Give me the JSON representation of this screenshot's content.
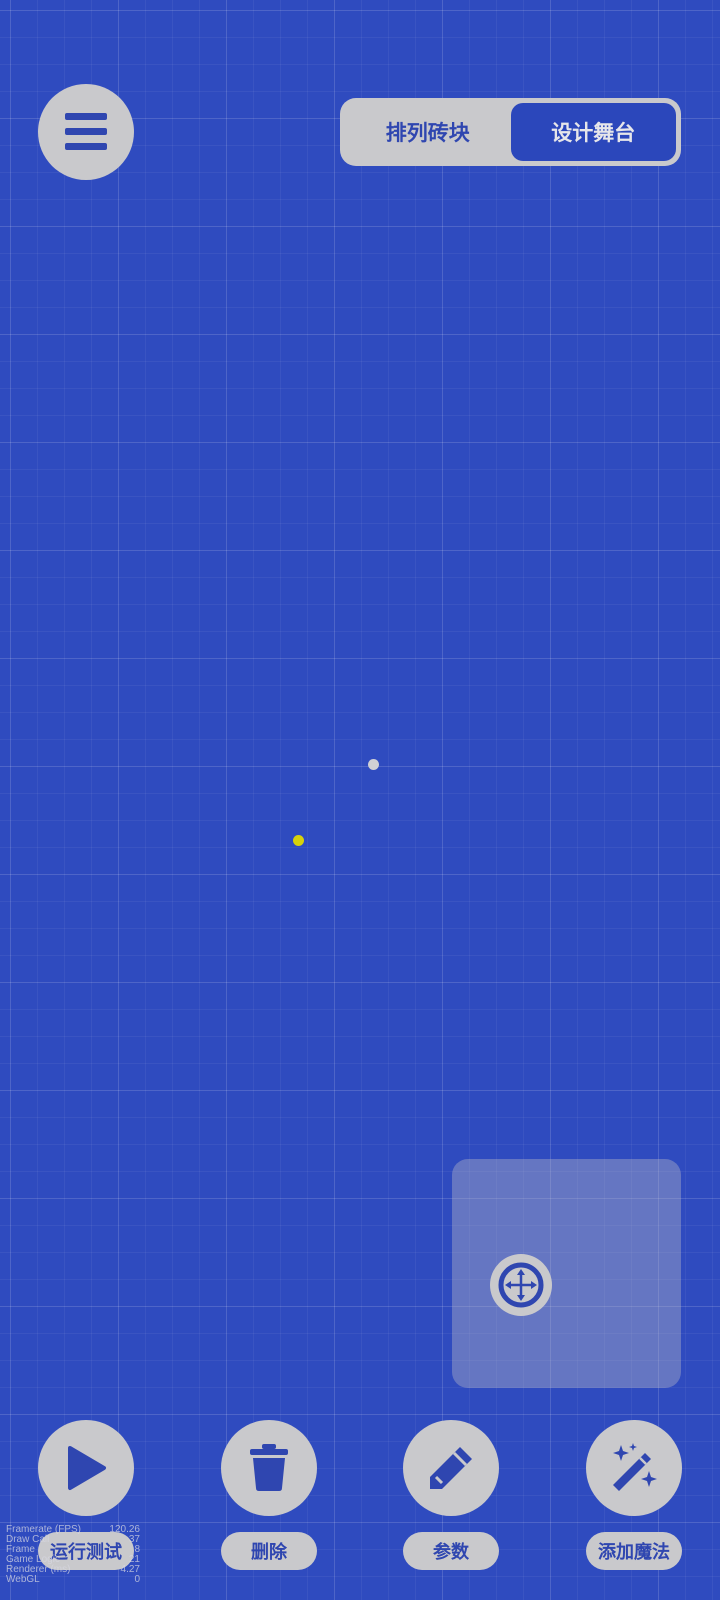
{
  "header": {
    "menu_icon": "hamburger-menu-icon",
    "mode_tabs": [
      {
        "label": "排列砖块",
        "active": false
      },
      {
        "label": "设计舞台",
        "active": true
      }
    ]
  },
  "stage": {
    "dots": [
      {
        "name": "white-dot",
        "color": "#d0d0d4"
      },
      {
        "name": "yellow-dot",
        "color": "#d7d20a"
      }
    ]
  },
  "joystick": {
    "icon": "move-arrows-icon"
  },
  "toolbar": {
    "run": {
      "label": "运行测试",
      "icon": "play-icon"
    },
    "delete": {
      "label": "删除",
      "icon": "trash-icon"
    },
    "params": {
      "label": "参数",
      "icon": "pencil-icon"
    },
    "magic": {
      "label": "添加魔法",
      "icon": "magic-wand-icon"
    }
  },
  "debug_stats": [
    {
      "label": "Framerate (FPS)",
      "value": "120.26"
    },
    {
      "label": "Draw Call",
      "value": "37"
    },
    {
      "label": "Frame",
      "value": "8"
    },
    {
      "label": "Game Logic",
      "value": "21"
    },
    {
      "label": "Renderer (ms)",
      "value": "4.27"
    },
    {
      "label": "WebGL",
      "value": "0"
    }
  ],
  "colors": {
    "background": "#2f4bbf",
    "button": "#c9c9cc",
    "accent": "#2f46b0"
  }
}
